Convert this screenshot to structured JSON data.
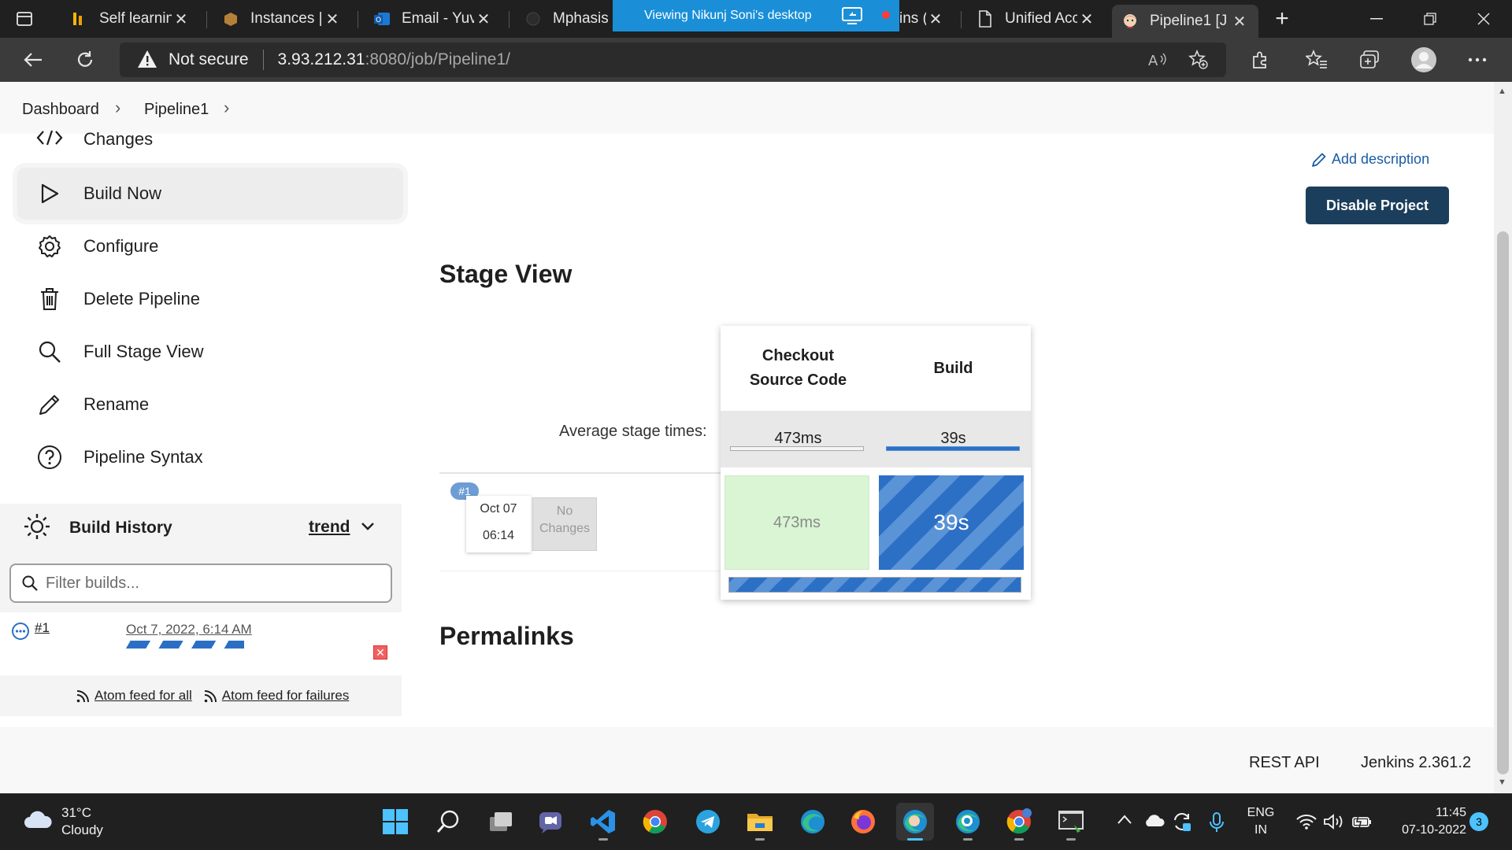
{
  "browser": {
    "tabs": [
      {
        "title": "Self learning",
        "icon": "bar-chart-icon"
      },
      {
        "title": "Instances | E",
        "icon": "aws-box-icon"
      },
      {
        "title": "Email - Yuva",
        "icon": "outlook-icon"
      },
      {
        "title": "Mphasis-",
        "icon": "github-icon"
      },
      {
        "title": "ins (",
        "icon": ""
      },
      {
        "title": "Unified Acc",
        "icon": "page-icon"
      },
      {
        "title": "Pipeline1 [J",
        "icon": "jenkins-icon"
      }
    ],
    "share_banner": "Viewing Nikunj Soni's desktop",
    "security_label": "Not secure",
    "url_host": "3.93.212.31",
    "url_rest": ":8080/job/Pipeline1/"
  },
  "breadcrumb": {
    "items": [
      "Dashboard",
      "Pipeline1"
    ]
  },
  "sidebar": {
    "items": [
      {
        "label": "Changes",
        "icon": "code-icon"
      },
      {
        "label": "Build Now",
        "icon": "play-icon"
      },
      {
        "label": "Configure",
        "icon": "gear-icon"
      },
      {
        "label": "Delete Pipeline",
        "icon": "trash-icon"
      },
      {
        "label": "Full Stage View",
        "icon": "search-icon"
      },
      {
        "label": "Rename",
        "icon": "pencil-icon"
      },
      {
        "label": "Pipeline Syntax",
        "icon": "help-icon"
      }
    ]
  },
  "build_history": {
    "title": "Build History",
    "trend_label": "trend",
    "filter_placeholder": "Filter builds...",
    "builds": [
      {
        "number": "#1",
        "date": "Oct 7, 2022, 6:14 AM"
      }
    ],
    "feed_all": "Atom feed for all",
    "feed_failures": "Atom feed for failures"
  },
  "main": {
    "add_description": "Add description",
    "disable_button": "Disable Project",
    "stage_view_title": "Stage View",
    "permalinks_title": "Permalinks"
  },
  "stage_view": {
    "avg_label": "Average stage times:",
    "stages": [
      {
        "name_line1": "Checkout",
        "name_line2": "Source Code",
        "avg": "473ms"
      },
      {
        "name_line1": "Build",
        "name_line2": "",
        "avg": "39s"
      }
    ],
    "run": {
      "badge": "#1",
      "date": "Oct 07",
      "time": "06:14",
      "changes_line1": "No",
      "changes_line2": "Changes",
      "cells": [
        "473ms",
        "39s"
      ]
    }
  },
  "footer": {
    "rest_api": "REST API",
    "version": "Jenkins 2.361.2"
  },
  "taskbar": {
    "weather_temp": "31°C",
    "weather_cond": "Cloudy",
    "lang_line1": "ENG",
    "lang_line2": "IN",
    "time": "11:45",
    "date": "07-10-2022",
    "notifications": "3"
  },
  "colors": {
    "jenkins_dark_button": "#1b3e5c",
    "success_cell": "#d9f5d3",
    "running_blue": "#2c70c6",
    "link_blue": "#1a5ba6"
  }
}
